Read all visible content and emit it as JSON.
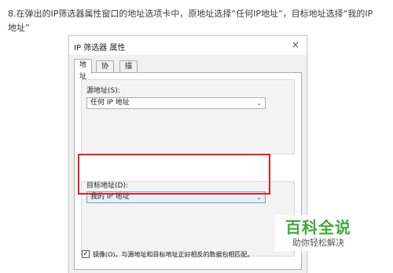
{
  "instruction": {
    "line1": "8.在弹出的IP筛选器属性窗口的地址选项卡中，原地址选择“任何IP地址”，目标地址选择“我的IP",
    "line2": "地址”"
  },
  "dialog": {
    "title": "IP 筛选器 属性",
    "close_glyph": "×",
    "tabs": [
      {
        "label": "地址",
        "active": true
      },
      {
        "label": "协议",
        "active": false
      },
      {
        "label": "描述",
        "active": false
      }
    ],
    "source": {
      "label": "源地址(S):",
      "value": "任何 IP 地址"
    },
    "destination": {
      "label": "目标地址(D):",
      "value": "我的 IP 地址"
    },
    "mirror": {
      "checked": true,
      "check_glyph": "✓",
      "label": "镜像(O)。与源地址和目标地址正好相反的数据包相匹配。"
    },
    "chevron_glyph": "⌄"
  },
  "watermark": {
    "title": "百科全说",
    "subtitle": "助你轻松解决"
  },
  "colors": {
    "highlight": "#e02020",
    "watermark_green": "#3cab3c",
    "panel_bg": "#f0f0f0"
  }
}
